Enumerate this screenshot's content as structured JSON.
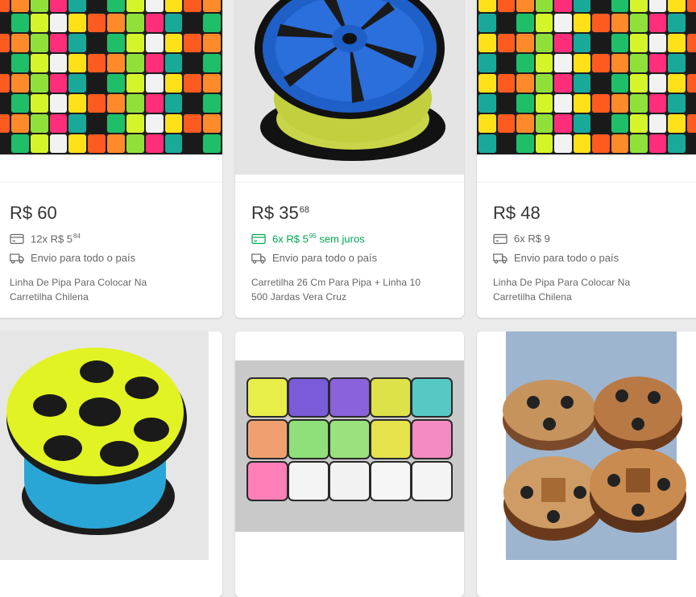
{
  "colors": {
    "background": "#ebebeb",
    "card": "#ffffff",
    "price": "#333333",
    "meta": "#666666",
    "installment_free": "#00a650"
  },
  "products": [
    {
      "price_integer": "R$ 60",
      "price_cents": "",
      "installment_prefix": "12x R$ 5",
      "installment_cents": "84",
      "installment_suffix": "",
      "installment_interest_free": false,
      "shipping": "Envio para todo o país",
      "title": "Linha De Pipa Para Colocar Na Carretilha Chilena",
      "image": "colorful-thread-spools-mosaic"
    },
    {
      "price_integer": "R$ 35",
      "price_cents": "68",
      "installment_prefix": "6x R$ 5",
      "installment_cents": "95",
      "installment_suffix": "sem juros",
      "installment_interest_free": true,
      "shipping": "Envio para todo o país",
      "title": "Carretilha 26 Cm Para Pipa + Linha 10 500 Jardas Vera Cruz",
      "image": "blue-wheel-spool-yellow-line"
    },
    {
      "price_integer": "R$ 48",
      "price_cents": "",
      "installment_prefix": "6x R$ 9",
      "installment_cents": "",
      "installment_suffix": "",
      "installment_interest_free": false,
      "shipping": "Envio para todo o país",
      "title": "Linha De Pipa Para Colocar Na Carretilha Chilena",
      "image": "colorful-thread-spools-mosaic"
    },
    {
      "image": "yellow-spool-blue-line"
    },
    {
      "image": "pastel-thread-rolls"
    },
    {
      "image": "wooden-spool-wheels"
    }
  ],
  "icons": {
    "installment": "credit-card-icon",
    "shipping": "truck-icon"
  }
}
